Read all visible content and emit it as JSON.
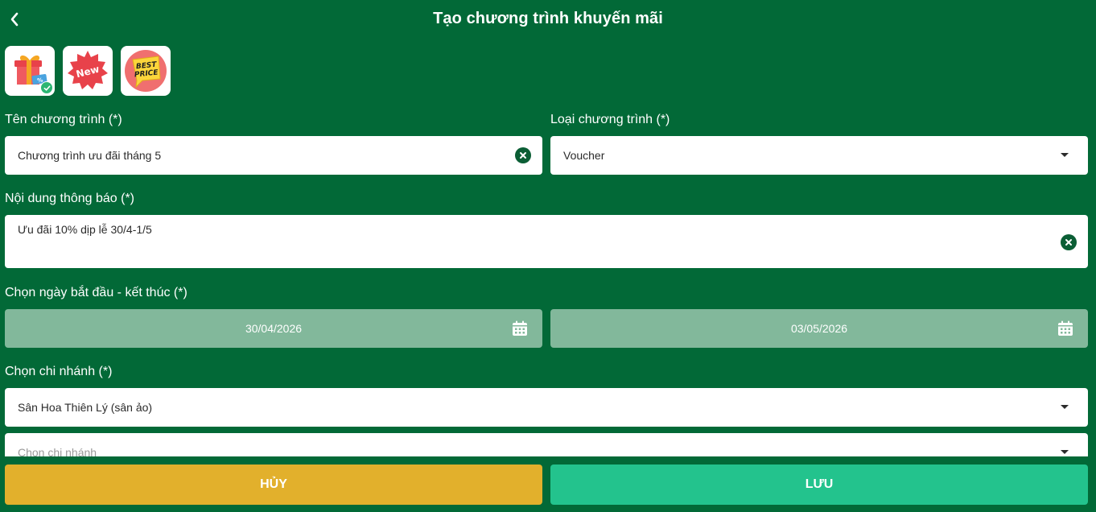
{
  "header": {
    "title": "Tạo chương trình khuyến mãi",
    "back_icon": "chevron-left-icon"
  },
  "templates": [
    {
      "name": "gift-voucher",
      "icon": "gift-icon",
      "selected": true
    },
    {
      "name": "new",
      "icon": "new-badge-icon",
      "badge_text": "New",
      "selected": false
    },
    {
      "name": "best-price",
      "icon": "best-price-icon",
      "badge_text": "BEST PRICE",
      "selected": false
    }
  ],
  "form": {
    "program_name": {
      "label": "Tên chương trình (*)",
      "value": "Chương trình ưu đãi tháng 5"
    },
    "program_type": {
      "label": "Loại chương trình (*)",
      "value": "Voucher"
    },
    "notification": {
      "label": "Nội dung thông báo (*)",
      "value": "Ưu đãi 10% dịp lễ 30/4-1/5"
    },
    "date_range": {
      "label": "Chọn ngày bắt đầu - kết thúc (*)",
      "start": "30/04/2026",
      "end": "03/05/2026"
    },
    "branch": {
      "label": "Chọn chi nhánh (*)",
      "value": "Sân Hoa Thiên Lý (sân ảo)",
      "placeholder": "Chọn chi nhánh"
    }
  },
  "actions": {
    "cancel_label": "HỦY",
    "save_label": "LƯU"
  },
  "colors": {
    "background": "#026937",
    "cancel": "#e2b02c",
    "save": "#23c38d",
    "date_field": "#82b89b"
  }
}
